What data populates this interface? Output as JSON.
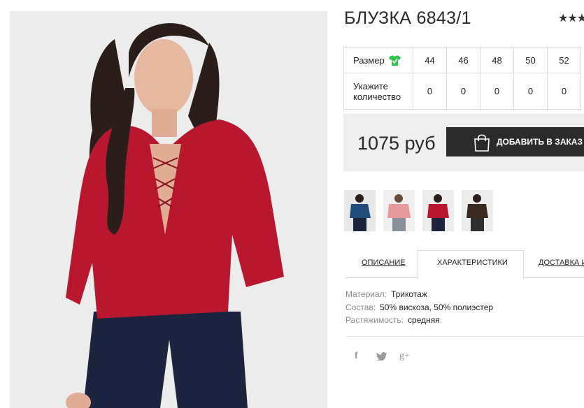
{
  "product": {
    "title": "БЛУЗКА 6843/1",
    "rating_stars": "★★★"
  },
  "sizes": {
    "size_label": "Размер",
    "qty_label_1": "Укажите",
    "qty_label_2": "количество",
    "values": [
      "44",
      "46",
      "48",
      "50",
      "52"
    ],
    "quantities": [
      "0",
      "0",
      "0",
      "0",
      "0"
    ]
  },
  "purchase": {
    "price": "1075 руб",
    "order_button": "ДОБАВИТЬ В ЗАКАЗ"
  },
  "colors": {
    "photo_bg": "#ececec",
    "blouse": "#b8172d",
    "pants": "#1c2440",
    "accent_green": "#2ec24a",
    "button_bg": "#2b2b2b"
  },
  "thumbnails": [
    "blue",
    "pink",
    "red",
    "black"
  ],
  "tabs": {
    "description": "ОПИСАНИЕ",
    "characteristics": "ХАРАКТЕРИСТИКИ",
    "delivery": "ДОСТАВКА И"
  },
  "characteristics": [
    {
      "key": "Материал:",
      "value": "Трикотаж"
    },
    {
      "key": "Состав:",
      "value": "50% вискоза, 50% полиэстер"
    },
    {
      "key": "Растяжимость:",
      "value": "средняя"
    }
  ],
  "social": {
    "facebook": "f",
    "twitter": "✔",
    "google": "g+"
  }
}
